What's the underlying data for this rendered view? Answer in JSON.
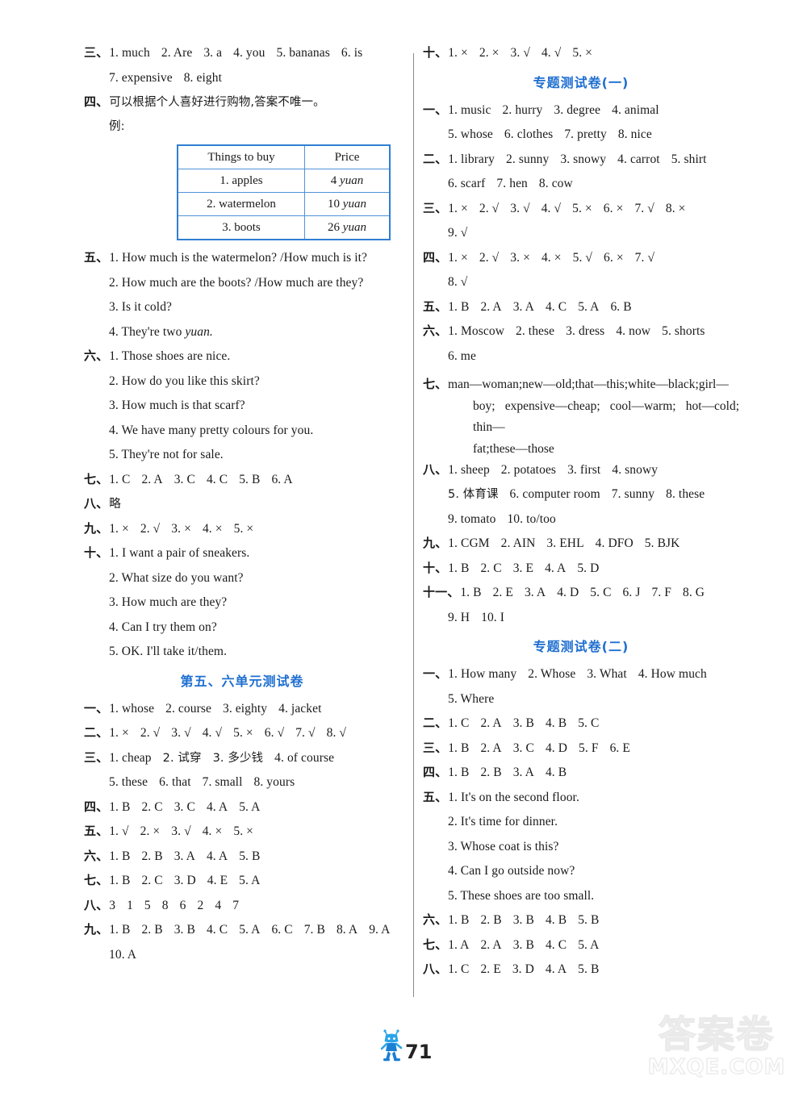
{
  "page": {
    "number": "71",
    "mascot_icon": "cartoon-robot-mascot-icon",
    "watermark_top": "答案卷",
    "watermark_bottom": "MXQE.COM"
  },
  "left_column": {
    "blocks": [
      {
        "id": "l-san",
        "marker": "三、",
        "lines": [
          {
            "indent": false,
            "items": [
              "1. much",
              "2. Are",
              "3. a",
              "4. you",
              "5. bananas",
              "6. is"
            ]
          },
          {
            "indent": true,
            "items": [
              "7. expensive",
              "8. eight"
            ]
          }
        ]
      },
      {
        "id": "l-si",
        "marker": "四、",
        "text": "可以根据个人喜好进行购物,答案不唯一。",
        "sub_text": "例:"
      },
      {
        "id": "table-things-to-buy",
        "type": "table",
        "headers": [
          "Things to buy",
          "Price"
        ],
        "rows": [
          [
            "1. apples",
            "4 yuan"
          ],
          [
            "2. watermelon",
            "10 yuan"
          ],
          [
            "3. boots",
            "26 yuan"
          ]
        ]
      },
      {
        "id": "l-wu",
        "marker": "五、",
        "lines": [
          {
            "indent": false,
            "text": "1. How much is the watermelon? /How much is it?"
          },
          {
            "indent": true,
            "text": "2. How much are the boots? /How much are they?"
          },
          {
            "indent": true,
            "text": "3. Is it cold?"
          },
          {
            "indent": true,
            "text": "4. They're two yuan."
          }
        ]
      },
      {
        "id": "l-liu",
        "marker": "六、",
        "lines": [
          {
            "indent": false,
            "text": "1. Those shoes are nice."
          },
          {
            "indent": true,
            "text": "2. How do you like this skirt?"
          },
          {
            "indent": true,
            "text": "3. How much is that scarf?"
          },
          {
            "indent": true,
            "text": "4. We have many pretty colours for you."
          },
          {
            "indent": true,
            "text": "5. They're not for sale."
          }
        ]
      },
      {
        "id": "l-qi",
        "marker": "七、",
        "lines": [
          {
            "indent": false,
            "items": [
              "1. C",
              "2. A",
              "3. C",
              "4. C",
              "5. B",
              "6. A"
            ]
          }
        ]
      },
      {
        "id": "l-ba",
        "marker": "八、",
        "text": "略"
      },
      {
        "id": "l-jiu",
        "marker": "九、",
        "lines": [
          {
            "indent": false,
            "items": [
              "1. ×",
              "2. √",
              "3. ×",
              "4. ×",
              "5. ×"
            ]
          }
        ]
      },
      {
        "id": "l-shi",
        "marker": "十、",
        "lines": [
          {
            "indent": false,
            "text": "1. I want a pair of sneakers."
          },
          {
            "indent": true,
            "text": "2. What size do you want?"
          },
          {
            "indent": true,
            "text": "3. How much are they?"
          },
          {
            "indent": true,
            "text": "4. Can I try them on?"
          },
          {
            "indent": true,
            "text": "5. OK. I'll take it/them."
          }
        ]
      },
      {
        "id": "heading-unit56",
        "type": "heading",
        "text": "第五、六单元测试卷"
      },
      {
        "id": "l2-yi",
        "marker": "一、",
        "lines": [
          {
            "indent": false,
            "items": [
              "1. whose",
              "2. course",
              "3. eighty",
              "4. jacket"
            ]
          }
        ]
      },
      {
        "id": "l2-er",
        "marker": "二、",
        "lines": [
          {
            "indent": false,
            "items": [
              "1. ×",
              "2. √",
              "3. √",
              "4. √",
              "5. ×",
              "6. √",
              "7. √",
              "8. √"
            ]
          }
        ]
      },
      {
        "id": "l2-san",
        "marker": "三、",
        "lines": [
          {
            "indent": false,
            "items": [
              "1. cheap",
              "2. 试穿",
              "3. 多少钱",
              "4. of course"
            ]
          },
          {
            "indent": true,
            "items": [
              "5. these",
              "6. that",
              "7. small",
              "8. yours"
            ]
          }
        ]
      },
      {
        "id": "l2-si",
        "marker": "四、",
        "lines": [
          {
            "indent": false,
            "items": [
              "1. B",
              "2. C",
              "3. C",
              "4. A",
              "5. A"
            ]
          }
        ]
      },
      {
        "id": "l2-wu",
        "marker": "五、",
        "lines": [
          {
            "indent": false,
            "items": [
              "1. √",
              "2. ×",
              "3. √",
              "4. ×",
              "5. ×"
            ]
          }
        ]
      },
      {
        "id": "l2-liu",
        "marker": "六、",
        "lines": [
          {
            "indent": false,
            "items": [
              "1. B",
              "2. B",
              "3. A",
              "4. A",
              "5. B"
            ]
          }
        ]
      },
      {
        "id": "l2-qi",
        "marker": "七、",
        "lines": [
          {
            "indent": false,
            "items": [
              "1. B",
              "2. C",
              "3. D",
              "4. E",
              "5. A"
            ]
          }
        ]
      },
      {
        "id": "l2-ba",
        "marker": "八、",
        "lines": [
          {
            "indent": false,
            "items": [
              "3",
              "1",
              "5",
              "8",
              "6",
              "2",
              "4",
              "7"
            ]
          }
        ]
      },
      {
        "id": "l2-jiu",
        "marker": "九、",
        "lines": [
          {
            "indent": false,
            "items": [
              "1. B",
              "2. B",
              "3. B",
              "4. C",
              "5. A",
              "6. C",
              "7. B",
              "8. A",
              "9. A"
            ]
          },
          {
            "indent": true,
            "items": [
              "10. A"
            ]
          }
        ]
      }
    ]
  },
  "right_column": {
    "blocks": [
      {
        "id": "r-shi",
        "marker": "十、",
        "lines": [
          {
            "indent": false,
            "items": [
              "1. ×",
              "2. ×",
              "3. √",
              "4. √",
              "5. ×"
            ]
          }
        ]
      },
      {
        "id": "heading-special1",
        "type": "heading",
        "text": "专题测试卷(一)"
      },
      {
        "id": "r1-yi",
        "marker": "一、",
        "lines": [
          {
            "indent": false,
            "items": [
              "1. music",
              "2. hurry",
              "3. degree",
              "4. animal"
            ]
          },
          {
            "indent": true,
            "items": [
              "5. whose",
              "6. clothes",
              "7. pretty",
              "8. nice"
            ]
          }
        ]
      },
      {
        "id": "r1-er",
        "marker": "二、",
        "lines": [
          {
            "indent": false,
            "items": [
              "1. library",
              "2. sunny",
              "3. snowy",
              "4. carrot",
              "5. shirt"
            ]
          },
          {
            "indent": true,
            "items": [
              "6. scarf",
              "7. hen",
              "8. cow"
            ]
          }
        ]
      },
      {
        "id": "r1-san",
        "marker": "三、",
        "lines": [
          {
            "indent": false,
            "items": [
              "1. ×",
              "2. √",
              "3. √",
              "4. √",
              "5. ×",
              "6. ×",
              "7. √",
              "8. ×"
            ]
          },
          {
            "indent": true,
            "items": [
              "9. √"
            ]
          }
        ]
      },
      {
        "id": "r1-si",
        "marker": "四、",
        "lines": [
          {
            "indent": false,
            "items": [
              "1. ×",
              "2. √",
              "3. ×",
              "4. ×",
              "5. √",
              "6. ×",
              "7. √"
            ]
          },
          {
            "indent": true,
            "items": [
              "8. √"
            ]
          }
        ]
      },
      {
        "id": "r1-wu",
        "marker": "五、",
        "lines": [
          {
            "indent": false,
            "items": [
              "1. B",
              "2. A",
              "3. A",
              "4. C",
              "5. A",
              "6. B"
            ]
          }
        ]
      },
      {
        "id": "r1-liu",
        "marker": "六、",
        "lines": [
          {
            "indent": false,
            "items": [
              "1. Moscow",
              "2. these",
              "3. dress",
              "4. now",
              "5. shorts"
            ]
          },
          {
            "indent": true,
            "items": [
              "6. me"
            ]
          }
        ]
      },
      {
        "id": "r1-qi",
        "marker": "七、",
        "type": "paragraph",
        "paragraph_lines": [
          "man—woman;new—old;that—this;white—black;girl—",
          "boy; expensive—cheap; cool—warm; hot—cold; thin—",
          "fat;these—those"
        ]
      },
      {
        "id": "r1-ba",
        "marker": "八、",
        "lines": [
          {
            "indent": false,
            "items": [
              "1. sheep",
              "2. potatoes",
              "3. first",
              "4. snowy"
            ]
          },
          {
            "indent": true,
            "items": [
              "5. 体育课",
              "6. computer room",
              "7. sunny",
              "8. these"
            ]
          },
          {
            "indent": true,
            "items": [
              "9. tomato",
              "10. to/too"
            ]
          }
        ]
      },
      {
        "id": "r1-jiu",
        "marker": "九、",
        "lines": [
          {
            "indent": false,
            "items": [
              "1. CGM",
              "2. AIN",
              "3. EHL",
              "4. DFO",
              "5. BJK"
            ]
          }
        ]
      },
      {
        "id": "r1-shi",
        "marker": "十、",
        "lines": [
          {
            "indent": false,
            "items": [
              "1. B",
              "2. C",
              "3. E",
              "4. A",
              "5. D"
            ]
          }
        ]
      },
      {
        "id": "r1-shiyi",
        "marker": "十一、",
        "lines": [
          {
            "indent": false,
            "items": [
              "1. B",
              "2. E",
              "3. A",
              "4. D",
              "5. C",
              "6. J",
              "7. F",
              "8. G"
            ]
          },
          {
            "indent": true,
            "items": [
              "9. H",
              "10. I"
            ]
          }
        ]
      },
      {
        "id": "heading-special2",
        "type": "heading",
        "text": "专题测试卷(二)"
      },
      {
        "id": "r2-yi",
        "marker": "一、",
        "lines": [
          {
            "indent": false,
            "items": [
              "1. How many",
              "2. Whose",
              "3. What",
              "4. How much"
            ]
          },
          {
            "indent": true,
            "items": [
              "5. Where"
            ]
          }
        ]
      },
      {
        "id": "r2-er",
        "marker": "二、",
        "lines": [
          {
            "indent": false,
            "items": [
              "1. C",
              "2. A",
              "3. B",
              "4. B",
              "5. C"
            ]
          }
        ]
      },
      {
        "id": "r2-san",
        "marker": "三、",
        "lines": [
          {
            "indent": false,
            "items": [
              "1. B",
              "2. A",
              "3. C",
              "4. D",
              "5. F",
              "6. E"
            ]
          }
        ]
      },
      {
        "id": "r2-si",
        "marker": "四、",
        "lines": [
          {
            "indent": false,
            "items": [
              "1. B",
              "2. B",
              "3. A",
              "4. B"
            ]
          }
        ]
      },
      {
        "id": "r2-wu",
        "marker": "五、",
        "lines": [
          {
            "indent": false,
            "text": "1. It's on the second floor."
          },
          {
            "indent": true,
            "text": "2. It's time for dinner."
          },
          {
            "indent": true,
            "text": "3. Whose coat is this?"
          },
          {
            "indent": true,
            "text": "4. Can I go outside now?"
          },
          {
            "indent": true,
            "text": "5. These shoes are too small."
          }
        ]
      },
      {
        "id": "r2-liu",
        "marker": "六、",
        "lines": [
          {
            "indent": false,
            "items": [
              "1. B",
              "2. B",
              "3. B",
              "4. B",
              "5. B"
            ]
          }
        ]
      },
      {
        "id": "r2-qi",
        "marker": "七、",
        "lines": [
          {
            "indent": false,
            "items": [
              "1. A",
              "2. A",
              "3. B",
              "4. C",
              "5. A"
            ]
          }
        ]
      },
      {
        "id": "r2-ba",
        "marker": "八、",
        "lines": [
          {
            "indent": false,
            "items": [
              "1. C",
              "2. E",
              "3. D",
              "4. A",
              "5. B"
            ]
          }
        ]
      }
    ]
  },
  "colors": {
    "heading_blue": "#1f6fd0",
    "table_border_blue": "#2f7fd1",
    "text": "#1a1a1a"
  }
}
